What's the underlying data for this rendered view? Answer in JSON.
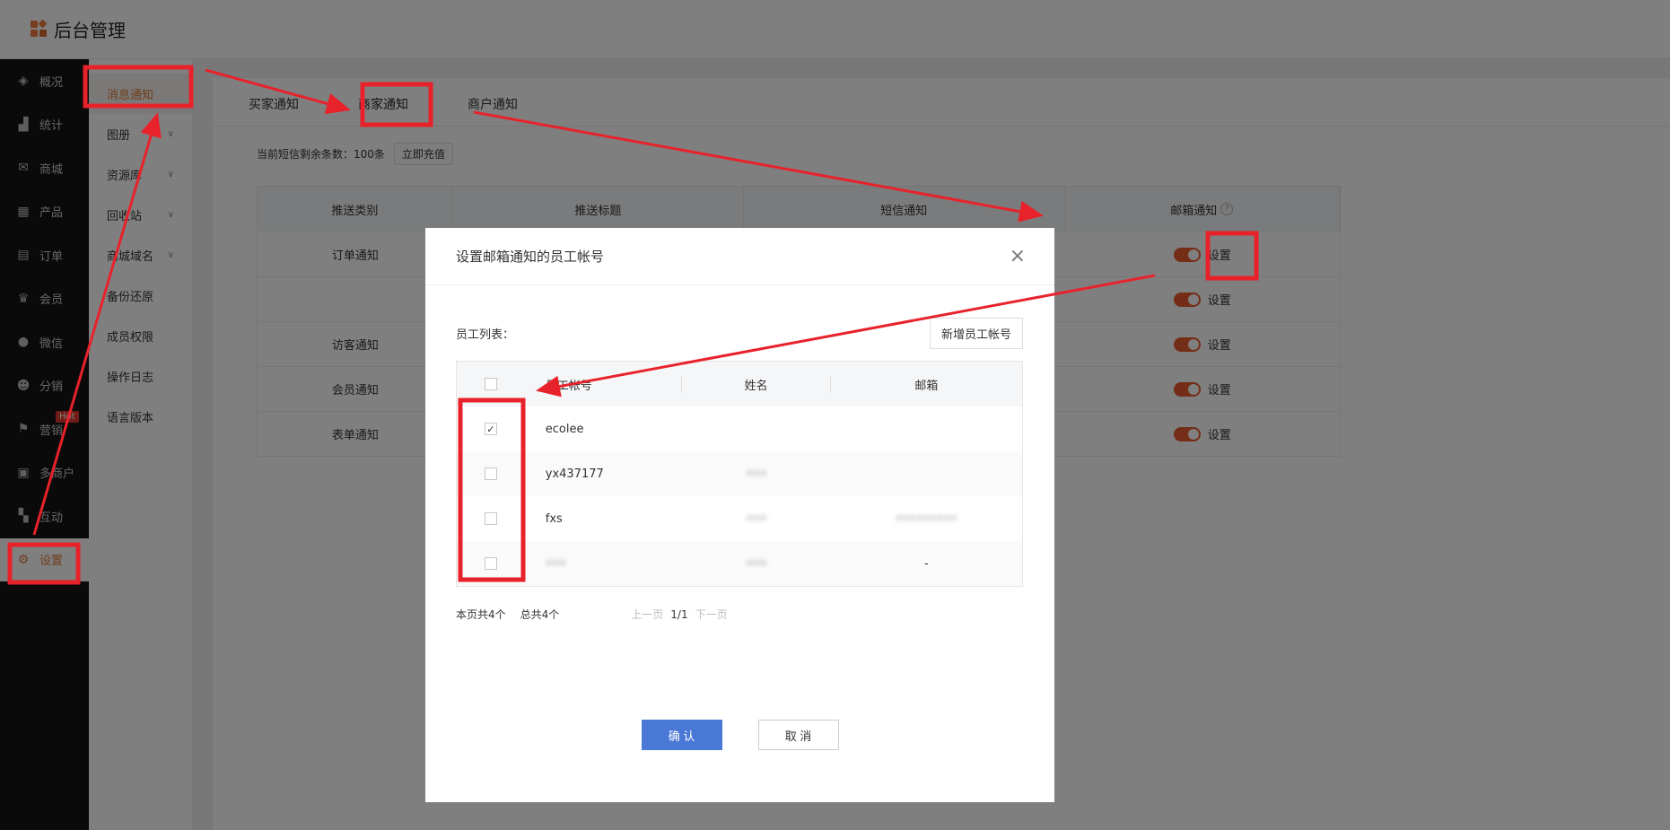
{
  "brand": {
    "title": "后台管理"
  },
  "sidebar": {
    "items": [
      {
        "label": "概况",
        "icon": "layers-icon"
      },
      {
        "label": "统计",
        "icon": "chart-icon"
      },
      {
        "label": "商城",
        "icon": "mail-icon"
      },
      {
        "label": "产品",
        "icon": "grid-icon"
      },
      {
        "label": "订单",
        "icon": "clipboard-icon"
      },
      {
        "label": "会员",
        "icon": "crown-icon"
      },
      {
        "label": "微信",
        "icon": "chat-icon"
      },
      {
        "label": "分销",
        "icon": "users-icon"
      },
      {
        "label": "营销",
        "icon": "flag-icon",
        "badge": "Hot"
      },
      {
        "label": "多商户",
        "icon": "shop-icon"
      },
      {
        "label": "互动",
        "icon": "people-icon"
      },
      {
        "label": "设置",
        "icon": "gear-icon"
      }
    ]
  },
  "subnav": {
    "items": [
      {
        "label": "消息通知"
      },
      {
        "label": "图册"
      },
      {
        "label": "资源库"
      },
      {
        "label": "回收站"
      },
      {
        "label": "商城域名"
      },
      {
        "label": "备份还原"
      },
      {
        "label": "成员权限"
      },
      {
        "label": "操作日志"
      },
      {
        "label": "语言版本"
      }
    ]
  },
  "tabs": [
    {
      "label": "买家通知"
    },
    {
      "label": "商家通知"
    },
    {
      "label": "商户通知"
    }
  ],
  "sms": {
    "text": "当前短信剩余条数：100条",
    "recharge": "立即充值"
  },
  "table": {
    "headers": [
      "推送类别",
      "推送标题",
      "短信通知",
      "邮箱通知"
    ],
    "help": "?",
    "rows": [
      {
        "category": "订单通知",
        "setting": "设置"
      },
      {
        "category": "",
        "setting": "设置"
      },
      {
        "category": "访客通知",
        "setting": "设置"
      },
      {
        "category": "会员通知",
        "setting": "设置"
      },
      {
        "category": "表单通知",
        "setting": "设置"
      }
    ]
  },
  "modal": {
    "title": "设置邮箱通知的员工帐号",
    "close": "×",
    "list_label": "员工列表：",
    "add_button": "新增员工帐号",
    "headers": [
      "员工帐号",
      "姓名",
      "邮箱"
    ],
    "rows": [
      {
        "account": "ecolee",
        "name": "",
        "email": "",
        "checked": true
      },
      {
        "account": "yx437177",
        "name": "•••",
        "email": "",
        "checked": false
      },
      {
        "account": "fxs",
        "name": "•••",
        "email": "•••••••••",
        "checked": false
      },
      {
        "account": "•••",
        "name": "•••",
        "email": "-",
        "checked": false
      }
    ],
    "pager": {
      "page_count": "本页共4个",
      "total": "总共4个",
      "prev": "上一页",
      "current": "1/1",
      "next": "下一页"
    },
    "confirm": "确 认",
    "cancel": "取 消"
  },
  "colors": {
    "accent": "#e07a3c",
    "toggle": "#e95a2c",
    "primary": "#4a78d6",
    "annotation": "#e8222b"
  }
}
